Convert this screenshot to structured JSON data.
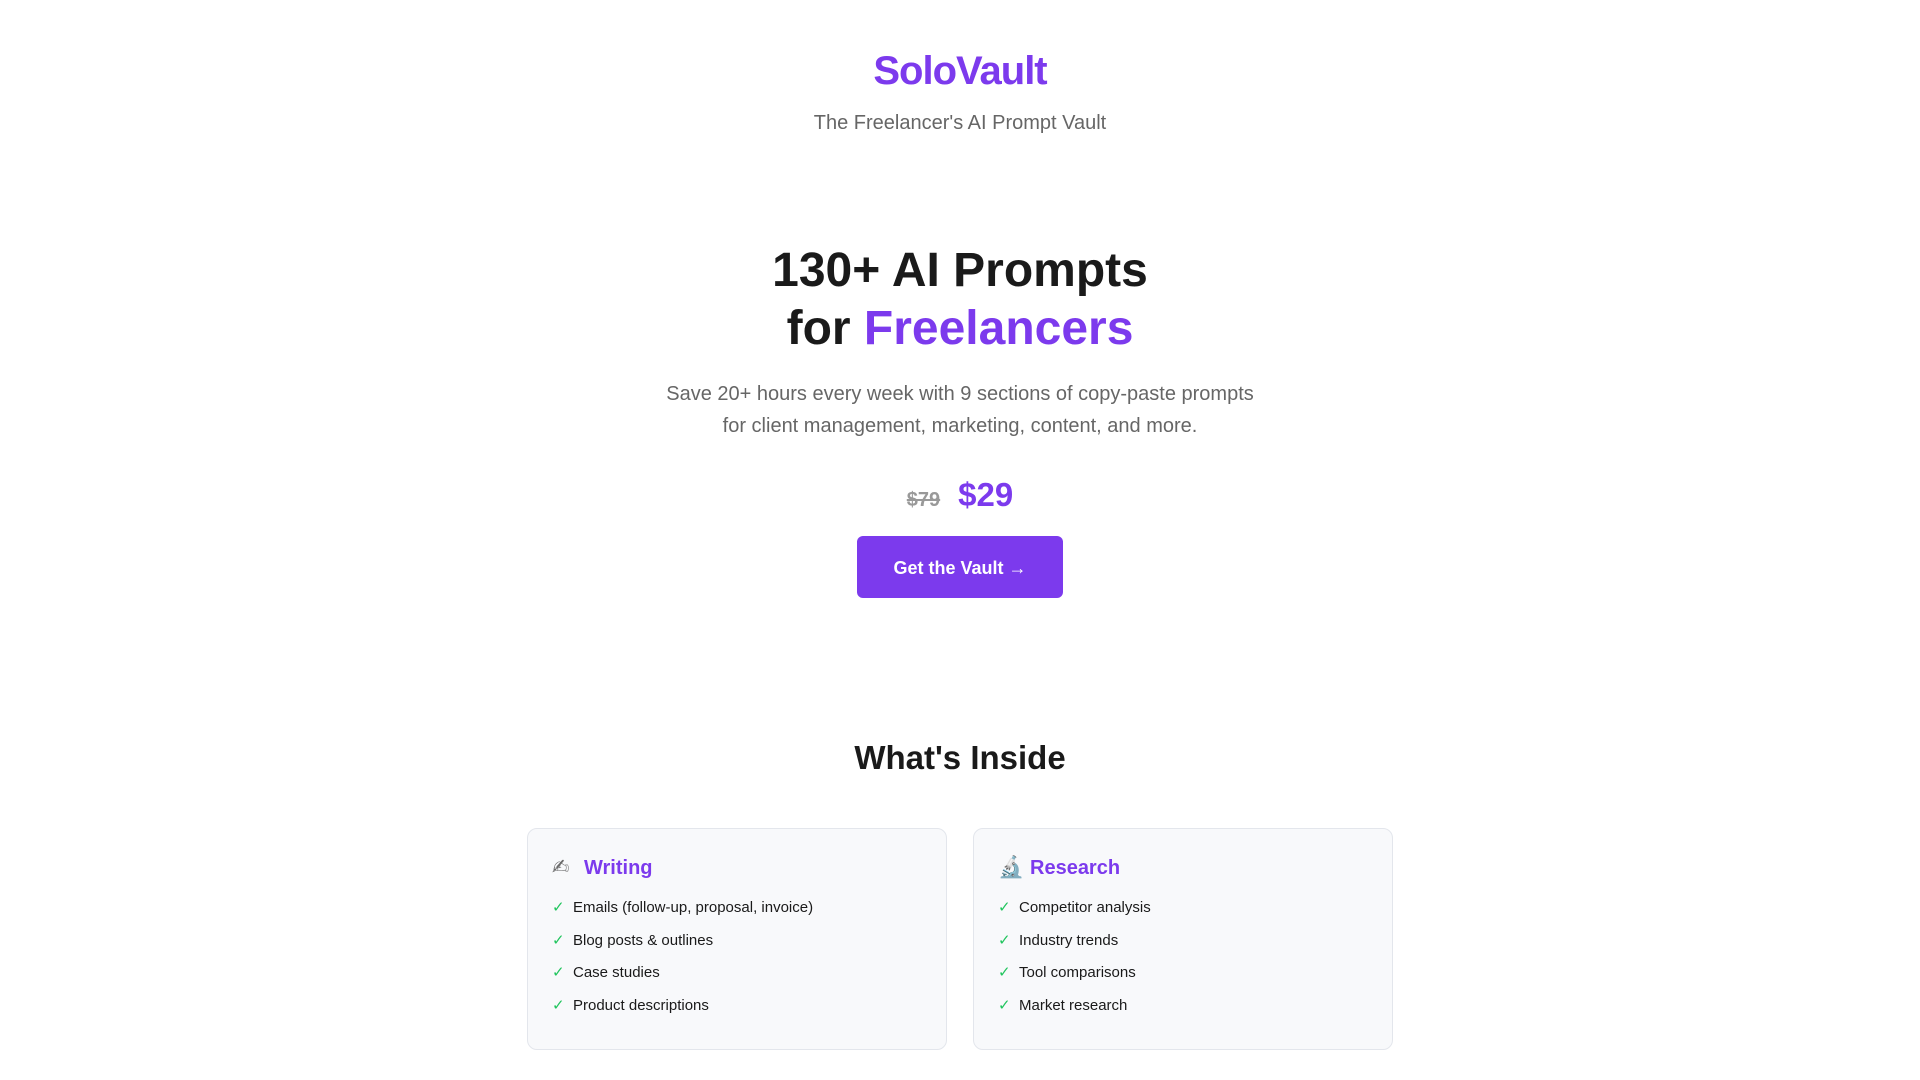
{
  "header": {
    "brand": "SoloVault",
    "tagline": "The Freelancer's AI Prompt Vault"
  },
  "hero": {
    "title_line1": "130+ AI Prompts",
    "title_line2_prefix": "for ",
    "title_line2_accent": "Freelancers",
    "subtitle_line1": "Save 20+ hours every week with 9 sections of copy-paste prompts",
    "subtitle_line2": "for client management, marketing, content, and more.",
    "price_old": "$79",
    "price_new": "$29",
    "cta_label": "Get the Vault →"
  },
  "inside": {
    "title": "What's Inside",
    "cards": [
      {
        "icon": "writing-hand-icon",
        "icon_glyph": "✍",
        "title": "Writing",
        "items": [
          "Emails (follow-up, proposal, invoice)",
          "Blog posts & outlines",
          "Case studies",
          "Product descriptions"
        ]
      },
      {
        "icon": "microscope-icon",
        "icon_glyph": "🔬",
        "title": "Research",
        "items": [
          "Competitor analysis",
          "Industry trends",
          "Tool comparisons",
          "Market research"
        ]
      }
    ]
  },
  "colors": {
    "accent": "#7c3aed",
    "check": "#22c55e",
    "muted_text": "#666666"
  }
}
